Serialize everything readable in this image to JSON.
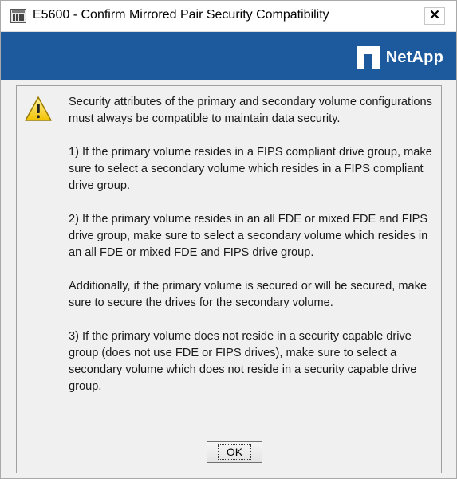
{
  "window": {
    "title": "E5600 - Confirm Mirrored Pair Security Compatibility",
    "close_label": "X",
    "app_icon": "storage-array-icon"
  },
  "brand": {
    "logo_text": "NetApp",
    "band_color": "#1d5a9d",
    "logo_icon": "netapp-logo-icon"
  },
  "dialog": {
    "icon": "warning-icon",
    "paragraphs": [
      "Security attributes of the primary and secondary volume configurations must always be compatible to maintain data security.",
      "1) If the primary volume resides in a FIPS compliant drive group, make sure to select a secondary volume which resides in a FIPS compliant drive group.",
      "2) If the primary volume resides in an all FDE or mixed FDE and FIPS drive group, make sure to select a secondary volume which resides in an all FDE or mixed FDE and FIPS drive group.",
      "Additionally, if the primary volume is secured or will be secured, make sure to secure the drives for the secondary volume.",
      "3) If the primary volume does not reside in a security capable drive group (does not use FDE or FIPS drives), make sure to select a secondary volume which does not reside in a security capable drive group."
    ],
    "ok_label": "OK"
  }
}
